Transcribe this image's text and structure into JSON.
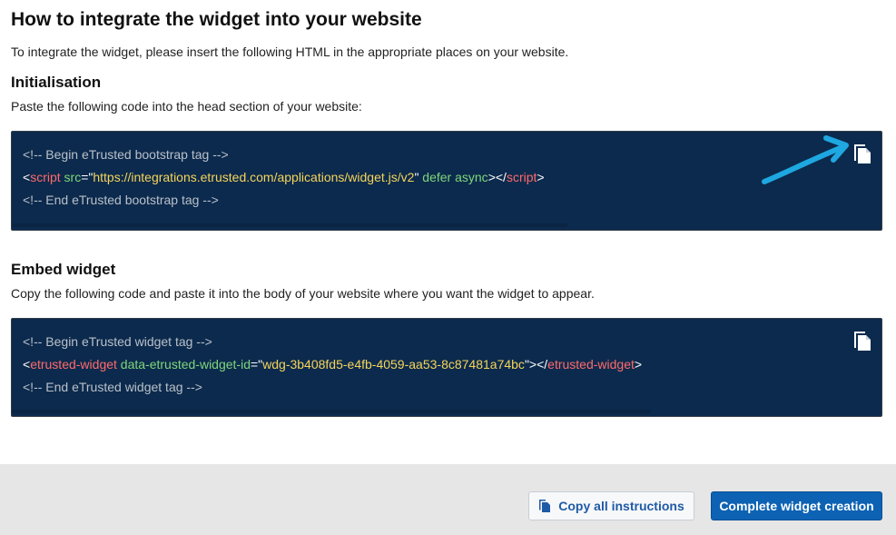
{
  "header": {
    "title": "How to integrate the widget into your website",
    "intro": "To integrate the widget, please insert the following HTML in the appropriate places on your website."
  },
  "initialisation": {
    "title": "Initialisation",
    "description": "Paste the following code into the head section of your website:",
    "code": {
      "comment_begin": "<!-- Begin eTrusted bootstrap tag -->",
      "lt": "<",
      "tag_open": "script",
      "attr_src": " src",
      "eq_quote": "=\"",
      "src_value": "https://integrations.etrusted.com/applications/widget.js/v2",
      "close_quote": "\"",
      "attrs_rest": " defer async",
      "gt_lt_slash": "></",
      "tag_close": "script",
      "gt": ">",
      "comment_end": "<!-- End eTrusted bootstrap tag -->"
    },
    "copy_icon": "copy-icon"
  },
  "embed": {
    "title": "Embed widget",
    "description": "Copy the following code and paste it into the body of your website where you want the widget to appear.",
    "code": {
      "comment_begin": "<!-- Begin eTrusted widget tag -->",
      "lt": "<",
      "tag_open": "etrusted-widget",
      "attr_id": " data-etrusted-widget-id",
      "eq_quote": "=\"",
      "id_value": "wdg-3b408fd5-e4fb-4059-aa53-8c87481a74bc",
      "close_quote": "\"",
      "gt_lt_slash": "></",
      "tag_close": "etrusted-widget",
      "gt": ">",
      "comment_end": "<!-- End eTrusted widget tag -->"
    },
    "copy_icon": "copy-icon"
  },
  "footer": {
    "copy_all_label": "Copy all instructions",
    "complete_label": "Complete widget creation"
  },
  "colors": {
    "code_background": "#0c2a4d",
    "arrow": "#1ea7e0",
    "primary_button": "#0d62b4",
    "footer_background": "#e6e6e6"
  }
}
